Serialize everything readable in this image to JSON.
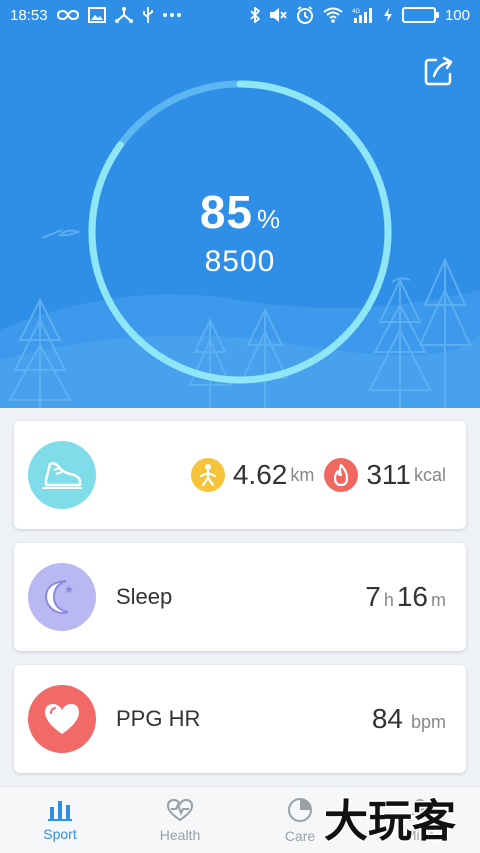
{
  "status_bar": {
    "time": "18:53",
    "battery": "100",
    "left_icons": [
      "infinity-icon",
      "image-icon",
      "share-nodes-icon",
      "usb-icon",
      "more-dots-icon"
    ],
    "right_icons": [
      "bluetooth-icon",
      "mute-icon",
      "alarm-icon",
      "wifi-icon",
      "signal-4g-icon",
      "charging-icon",
      "battery-icon"
    ]
  },
  "progress": {
    "percent": "85",
    "percent_sign": "%",
    "fraction": 0.85,
    "steps": "8500"
  },
  "activity": {
    "distance": "4.62",
    "distance_unit": "km",
    "calories": "311",
    "calories_unit": "kcal"
  },
  "sleep": {
    "label": "Sleep",
    "hours": "7",
    "hours_unit": "h",
    "minutes": "16",
    "minutes_unit": "m"
  },
  "heart": {
    "label": "PPG HR",
    "value": "84",
    "unit": "bpm"
  },
  "nav": {
    "items": [
      {
        "label": "Sport",
        "icon": "bar-chart-icon",
        "active": true
      },
      {
        "label": "Health",
        "icon": "heart-pulse-icon",
        "active": false
      },
      {
        "label": "Care",
        "icon": "pie-chart-icon",
        "active": false
      },
      {
        "label": "Mine",
        "icon": "person-icon",
        "active": false
      }
    ]
  },
  "watermark": "大玩客",
  "colors": {
    "primary": "#2f8fe6",
    "ring": "#8ee6f6",
    "shoe_bg": "#7fdde9",
    "moon_bg": "#b9b8f2",
    "heart_bg": "#f16a68",
    "distance_badge": "#f5c43a",
    "calorie_badge": "#f0685f"
  }
}
